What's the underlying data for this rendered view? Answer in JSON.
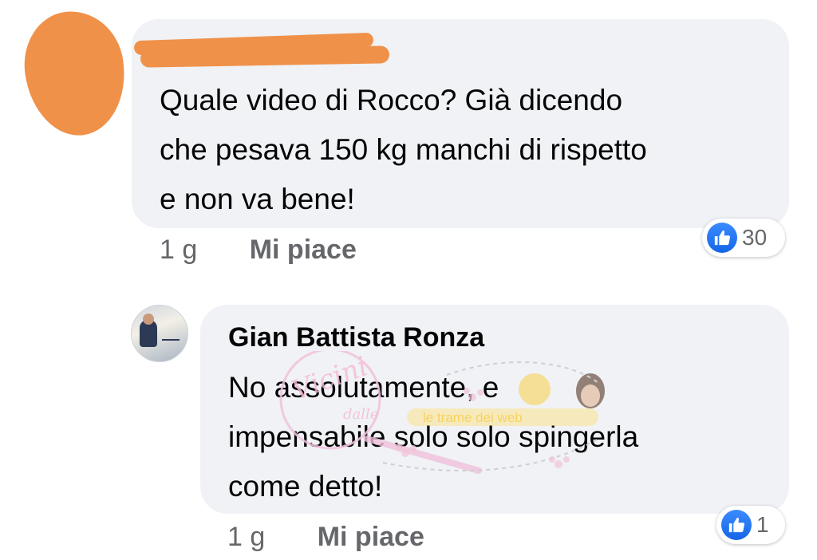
{
  "comments": [
    {
      "author": "",
      "text_lines": [
        "Quale video di Rocco? Già dicendo",
        "che pesava 150 kg manchi di rispetto",
        "e non va bene!"
      ],
      "time": "1 g",
      "like_label": "Mi piace",
      "reaction_count": "30"
    },
    {
      "author": "Gian Battista Ronza",
      "text_lines": [
        "No assolutamente, e",
        "impensabile solo solo spingerla",
        "come detto!"
      ],
      "time": "1 g",
      "like_label": "Mi piace",
      "reaction_count": "1"
    }
  ],
  "watermark": {
    "logo_text": "Vicini dalle",
    "banner_text": "le trame dei web"
  },
  "colors": {
    "bubble": "#f0f2f5",
    "like_blue": "#1877f2",
    "redaction": "#f0914a",
    "meta_gray": "#65676b"
  },
  "icons": [
    "like-thumb-icon",
    "avatar-redacted",
    "avatar-photo"
  ]
}
